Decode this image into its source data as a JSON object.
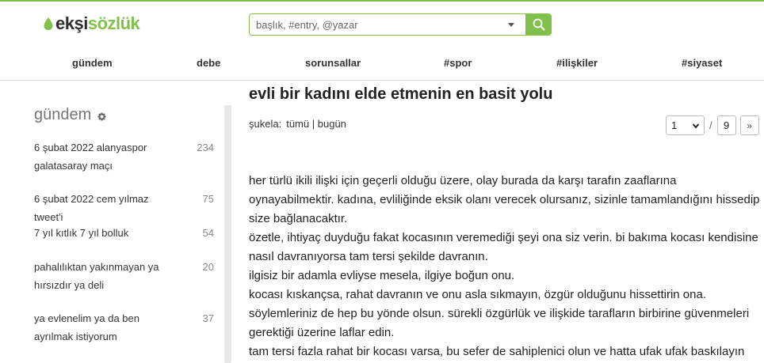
{
  "header": {
    "logo_part1": "ekşi",
    "logo_part2": "sözlük",
    "search_placeholder": "başlık, #entry, @yazar",
    "colors": {
      "brand": "#81c14b",
      "logo_dark": "#2e2e2e"
    }
  },
  "nav": {
    "items": [
      {
        "label": "gündem"
      },
      {
        "label": "debe"
      },
      {
        "label": "sorunsallar"
      },
      {
        "label": "#spor"
      },
      {
        "label": "#ilişkiler"
      },
      {
        "label": "#siyaset"
      }
    ]
  },
  "sidebar": {
    "title": "gündem",
    "icon": "gear-icon",
    "topics": [
      {
        "title": "6 şubat 2022 alanyaspor galatasaray maçı",
        "count": "234"
      },
      {
        "title": "6 şubat 2022 cem yılmaz tweet'i",
        "count": "75"
      },
      {
        "title": "7 yıl kıtlık 7 yıl bolluk",
        "count": "54"
      },
      {
        "title": "pahalılıktan yakınmayan ya hırsızdır ya deli",
        "count": "20"
      },
      {
        "title": "ya evlenelim ya da ben ayrılmak istiyorum",
        "count": "37"
      }
    ]
  },
  "topic": {
    "title": "evli bir kadını elde etmenin en basit yolu",
    "sukela_label": "şukela:",
    "sukela_all": "tümü",
    "sukela_sep": "|",
    "sukela_today": "bugün",
    "pager": {
      "current": "1",
      "sep": "/",
      "total": "9",
      "next": "»"
    },
    "entry_lines": [
      "her türlü ikili ilişki için geçerli olduğu üzere, olay burada da karşı tarafın zaafларına oynayabilmektir. kadına, evliliğinde eksik olanı verecek olursanız, sizinle tamamlandığını hissedip size bağlanacaktır.",
      "özetle, ihtiyaç duyduğu fakat kocasının veremediği şeyi ona siz verin. bi bakıma kocası kendisine nasıl davranıyorsa tam tersi şekilde davranın.",
      "ilgisiz bir adamla evliyse mesela, ilgiye boğun onu.",
      "kocası kıskançsa, rahat davranın ve onu asla sıkmayın, özgür olduğunu hissettirin ona.",
      "söylemleriniz de hep bu yönde olsun. sürekli özgürlük ve ilişkide tarafların birbirine güvenmeleri gerektiği üzerine laflar edin.",
      "tam tersi fazla rahat bir kocası varsa, bu sefer de sahiplenici olun ve hatta ufak ufak baskılayın"
    ]
  }
}
